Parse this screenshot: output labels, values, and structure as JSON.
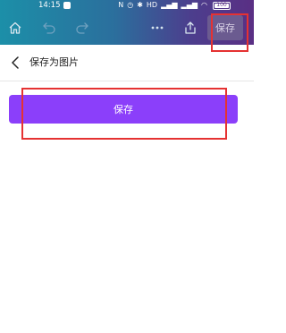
{
  "status_bar": {
    "time": "14:15",
    "battery": "100",
    "icons": [
      "nfc-icon",
      "alarm-icon",
      "bluetooth-icon",
      "hd-icon",
      "signal-icon",
      "signal-icon",
      "wifi-icon",
      "battery-icon"
    ]
  },
  "toolbar": {
    "home_icon": "home-icon",
    "undo_icon": "undo-icon",
    "redo_icon": "redo-icon",
    "more_icon": "more-icon",
    "share_icon": "share-icon",
    "save_label": "保存"
  },
  "header": {
    "back_icon": "chevron-left-icon",
    "title": "保存为图片"
  },
  "main": {
    "save_label": "保存"
  },
  "colors": {
    "gradient_start": "#1c8fa8",
    "gradient_end": "#5a2f84",
    "primary_button": "#8b3ffa",
    "highlight_frame": "#e53232"
  }
}
